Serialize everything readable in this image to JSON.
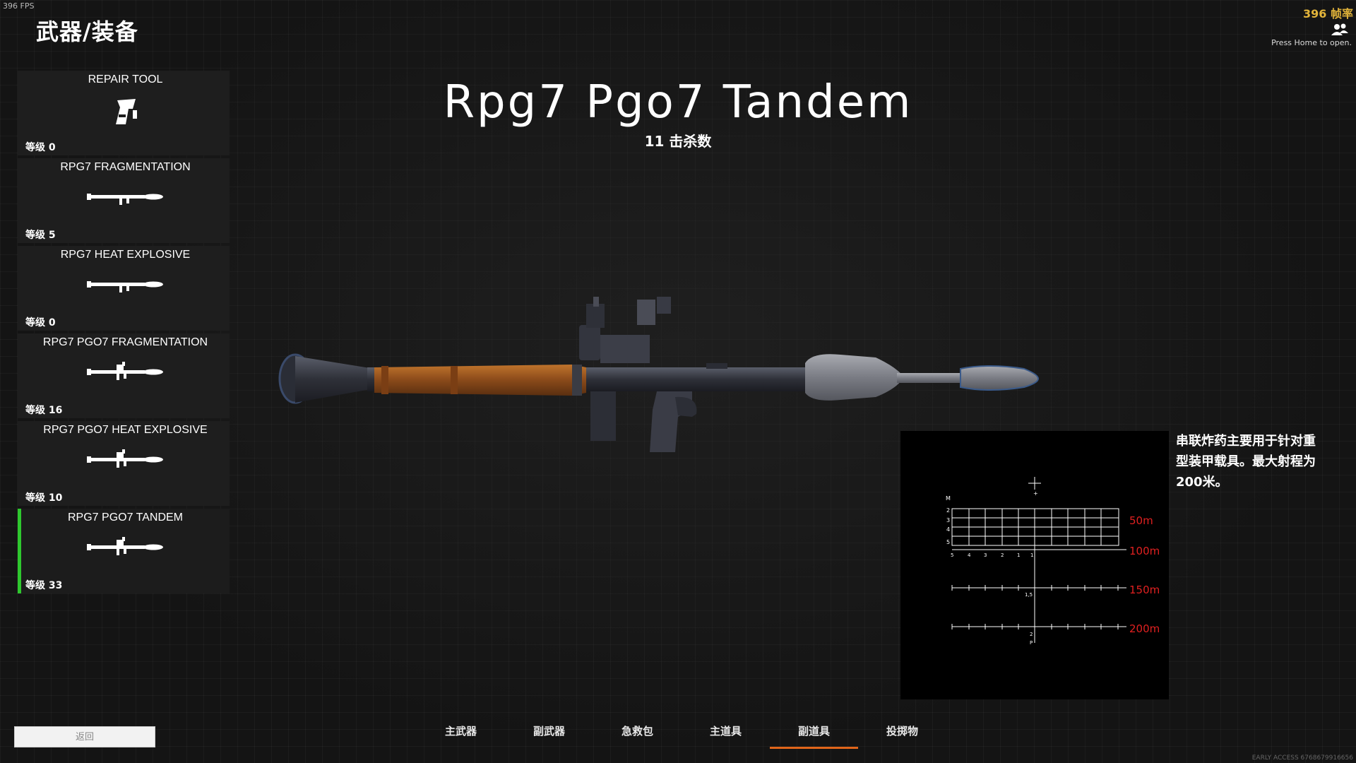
{
  "fps_overlay": "396 FPS",
  "fps_counter": "396 帧率",
  "home_hint": "Press Home to open.",
  "page_title": "武器/装备",
  "weapon_list": [
    {
      "name": "REPAIR TOOL",
      "level": "等级 0",
      "icon": "repair-tool-icon"
    },
    {
      "name": "RPG7 FRAGMENTATION",
      "level": "等级 5",
      "icon": "rpg7-icon"
    },
    {
      "name": "RPG7 HEAT EXPLOSIVE",
      "level": "等级 0",
      "icon": "rpg7-icon"
    },
    {
      "name": "RPG7 PGO7 FRAGMENTATION",
      "level": "等级 16",
      "icon": "rpg7-pgo7-icon"
    },
    {
      "name": "RPG7 PGO7 HEAT EXPLOSIVE",
      "level": "等级 10",
      "icon": "rpg7-pgo7-icon"
    },
    {
      "name": "RPG7 PGO7 TANDEM",
      "level": "等级 33",
      "icon": "rpg7-pgo7-icon",
      "selected": true
    }
  ],
  "weapon_title": "Rpg7 Pgo7 Tandem",
  "kill_count": "11 击杀数",
  "scope": {
    "range_labels": [
      "50m",
      "100m",
      "150m",
      "200m"
    ],
    "label_m": "M",
    "label_p": "P",
    "row_numbers": [
      "2",
      "3",
      "4",
      "5"
    ],
    "tick_numbers": [
      "5",
      "4",
      "3",
      "2",
      "1",
      "1"
    ],
    "mark_15": "1,5",
    "mark_2": "2",
    "range_color": "#e02020"
  },
  "description": "串联炸药主要用于针对重型装甲载具。最大射程为200米。",
  "back_button": "返回",
  "tabs": [
    "主武器",
    "副武器",
    "急救包",
    "主道具",
    "副道具",
    "投掷物"
  ],
  "active_tab": "副道具",
  "version": "EARLY ACCESS 6768679916656"
}
